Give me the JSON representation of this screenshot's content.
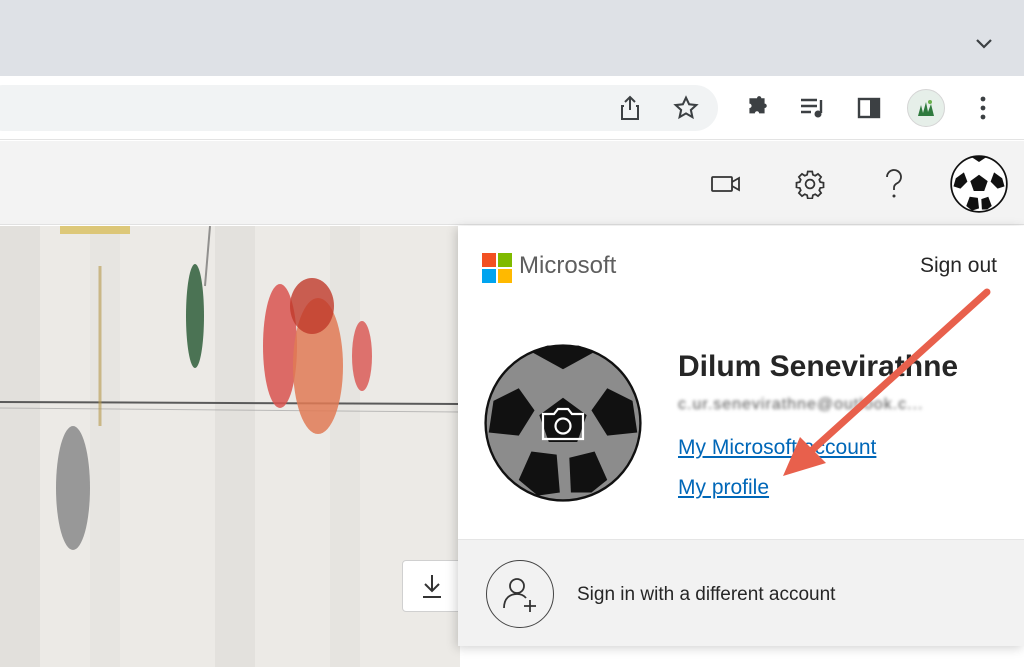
{
  "browser": {
    "icons": [
      "chevron-down-icon",
      "share-icon",
      "star-icon",
      "extensions-icon",
      "reading-list-icon",
      "side-panel-icon",
      "profile-icon",
      "kebab-menu-icon"
    ]
  },
  "app_header": {
    "icons": [
      "video-call-icon",
      "settings-icon",
      "help-icon",
      "account-avatar-icon"
    ]
  },
  "account_panel": {
    "brand": "Microsoft",
    "sign_out": "Sign out",
    "user_name": "Dilum Senevirathne",
    "email_obscured": "c.ur.senevirathne@outlook.c...",
    "link_account": "My Microsoft account",
    "link_profile": "My profile",
    "footer_label": "Sign in with a different account"
  },
  "colors": {
    "ms_red": "#f25022",
    "ms_green": "#7fba00",
    "ms_blue": "#00a4ef",
    "ms_yellow": "#ffb900",
    "link": "#0067b8",
    "annotation_arrow": "#e8604c"
  }
}
